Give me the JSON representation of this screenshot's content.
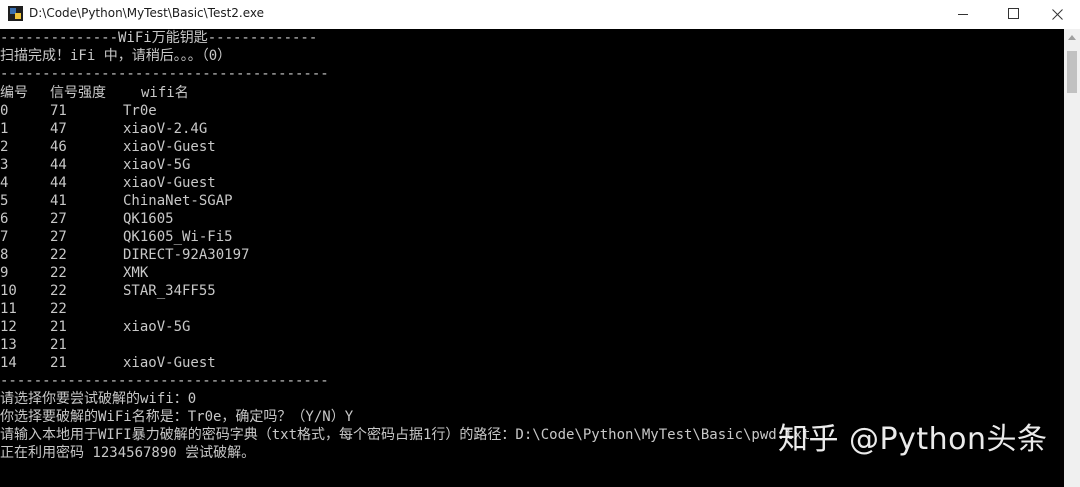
{
  "window": {
    "title": "D:\\Code\\Python\\MyTest\\Basic\\Test2.exe",
    "icon": "python-app-icon"
  },
  "console": {
    "header_line": "--------------WiFi万能钥匙-------------",
    "status_line": "扫描完成！iFi 中，请稍后。。。（0）",
    "separator_top": "---------------------------------------",
    "column_headers": {
      "num": "编号",
      "signal": "信号强度",
      "name": "wifi名"
    },
    "rows": [
      {
        "num": "0",
        "signal": "71",
        "name": "Tr0e"
      },
      {
        "num": "1",
        "signal": "47",
        "name": "xiaoV-2.4G"
      },
      {
        "num": "2",
        "signal": "46",
        "name": "xiaoV-Guest"
      },
      {
        "num": "3",
        "signal": "44",
        "name": "xiaoV-5G"
      },
      {
        "num": "4",
        "signal": "44",
        "name": "xiaoV-Guest"
      },
      {
        "num": "5",
        "signal": "41",
        "name": "ChinaNet-SGAP"
      },
      {
        "num": "6",
        "signal": "27",
        "name": "QK1605"
      },
      {
        "num": "7",
        "signal": "27",
        "name": "QK1605_Wi-Fi5"
      },
      {
        "num": "8",
        "signal": "22",
        "name": "DIRECT-92A30197"
      },
      {
        "num": "9",
        "signal": "22",
        "name": "XMK"
      },
      {
        "num": "10",
        "signal": "22",
        "name": "STAR_34FF55"
      },
      {
        "num": "11",
        "signal": "22",
        "name": ""
      },
      {
        "num": "12",
        "signal": "21",
        "name": "xiaoV-5G"
      },
      {
        "num": "13",
        "signal": "21",
        "name": ""
      },
      {
        "num": "14",
        "signal": "21",
        "name": "xiaoV-Guest"
      }
    ],
    "separator_bottom": "---------------------------------------",
    "prompt_select": "请选择你要尝试破解的wifi：0",
    "prompt_confirm": "你选择要破解的WiFi名称是：Tr0e，确定吗？（Y/N）Y",
    "prompt_dict": "请输入本地用于WIFI暴力破解的密码字典（txt格式，每个密码占据1行）的路径：D:\\Code\\Python\\MyTest\\Basic\\pwd.txt",
    "progress_line": "正在利用密码 1234567890 尝试破解。"
  },
  "watermark": "知乎 @Python头条",
  "colors": {
    "console_bg": "#000000",
    "console_text": "#c8c8c8",
    "titlebar_bg": "#ffffff"
  }
}
